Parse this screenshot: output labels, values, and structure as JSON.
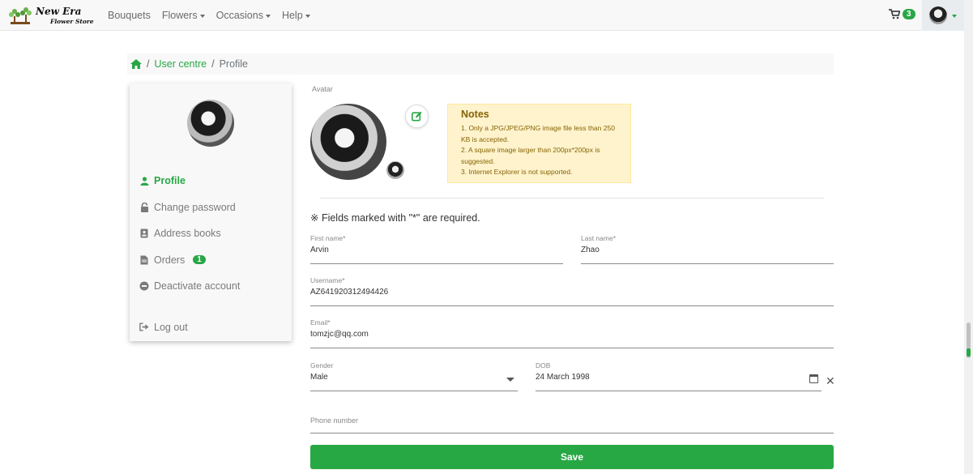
{
  "brand": {
    "name": "New Era",
    "subtitle": "Flower Store"
  },
  "nav": [
    {
      "label": "Bouquets",
      "has_dropdown": false
    },
    {
      "label": "Flowers",
      "has_dropdown": true
    },
    {
      "label": "Occasions",
      "has_dropdown": true
    },
    {
      "label": "Help",
      "has_dropdown": true
    }
  ],
  "cart": {
    "count": "3"
  },
  "breadcrumb": {
    "items": [
      "User centre",
      "Profile"
    ]
  },
  "sidebar": {
    "items": [
      {
        "label": "Profile",
        "icon": "user-icon",
        "active": true
      },
      {
        "label": "Change password",
        "icon": "lock-icon"
      },
      {
        "label": "Address books",
        "icon": "address-book-icon"
      },
      {
        "label": "Orders",
        "icon": "document-icon",
        "count": "1"
      },
      {
        "label": "Deactivate account",
        "icon": "minus-circle-icon"
      },
      {
        "label": "Log out",
        "icon": "sign-out-icon"
      }
    ]
  },
  "avatar": {
    "label": "Avatar"
  },
  "notes": {
    "title": "Notes",
    "lines": [
      "1. Only a JPG/JPEG/PNG image file less than 250 KB is accepted.",
      "2. A square image larger than 200px*200px is suggested.",
      "3. Internet Explorer is not supported."
    ]
  },
  "required_note": "※ Fields marked with \"*\" are required.",
  "form": {
    "first_name": {
      "label": "First name*",
      "value": "Arvin"
    },
    "last_name": {
      "label": "Last name*",
      "value": "Zhao"
    },
    "username": {
      "label": "Username*",
      "value": "AZ641920312494426"
    },
    "email": {
      "label": "Email*",
      "value": "tomzjc@qq.com"
    },
    "gender": {
      "label": "Gender",
      "value": "Male"
    },
    "dob": {
      "label": "DOB",
      "value": "24 March 1998"
    },
    "phone": {
      "label": "Phone number",
      "value": ""
    }
  },
  "save_label": "Save",
  "colors": {
    "accent": "#28a745",
    "notes_bg": "#fff3cd",
    "notes_text": "#856404"
  }
}
